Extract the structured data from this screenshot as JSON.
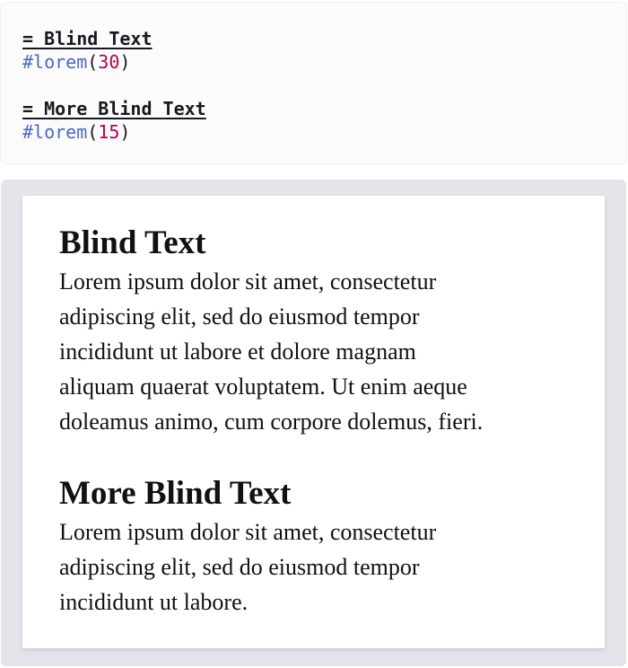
{
  "editor": {
    "lines": [
      {
        "heading": "= Blind Text"
      },
      {
        "fn": "#lorem",
        "open": "(",
        "num": "30",
        "close": ")"
      },
      {
        "blank": ""
      },
      {
        "heading": "= More Blind Text"
      },
      {
        "fn": "#lorem",
        "open": "(",
        "num": "15",
        "close": ")"
      }
    ]
  },
  "preview": {
    "sections": [
      {
        "heading": "Blind Text",
        "lines": [
          "Lorem ipsum dolor sit amet, consectetur",
          "adipiscing elit, sed do eiusmod tempor",
          "incididunt ut labore et dolore magnam",
          "aliquam quaerat voluptatem. Ut enim aeque",
          "doleamus animo, cum corpore dolemus, fieri."
        ]
      },
      {
        "heading": "More Blind Text",
        "lines": [
          "Lorem ipsum dolor sit amet, consectetur",
          "adipiscing elit, sed do eiusmod tempor",
          "incididunt ut labore."
        ]
      }
    ]
  },
  "colors": {
    "function": "#4b69c6",
    "number": "#b60157",
    "panel_bg": "#e4e5ea"
  }
}
